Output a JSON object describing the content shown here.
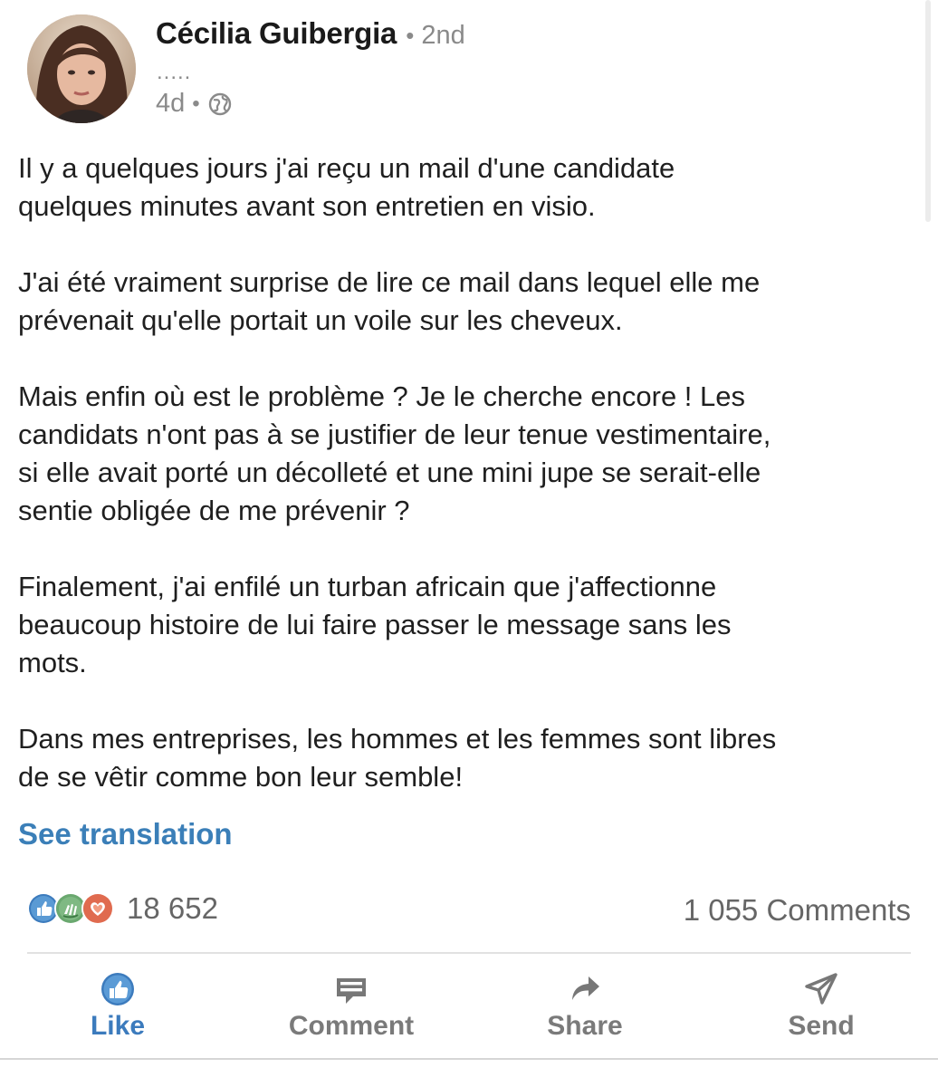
{
  "author": {
    "name": "Cécilia Guibergia",
    "separator": "•",
    "degree": "2nd",
    "headline": ".....",
    "time": "4d",
    "meta_separator": "•",
    "visibility_icon": "globe-icon"
  },
  "post": {
    "paragraphs": [
      "Il y a quelques jours j'ai reçu un mail d'une candidate\nquelques minutes avant son entretien en visio.",
      "J'ai été vraiment surprise de lire ce mail dans lequel elle me\nprévenait qu'elle portait un voile sur les cheveux.",
      "Mais enfin où est le problème ? Je le cherche encore ! Les\ncandidats n'ont pas à se justifier de leur tenue vestimentaire,\nsi elle avait porté un décolleté et une mini jupe se serait-elle\nsentie obligée de me prévenir ?",
      "Finalement, j'ai enfilé un turban africain que j'affectionne\nbeaucoup histoire de lui faire passer le message sans les\nmots.",
      "Dans mes entreprises, les hommes et les femmes sont libres\nde se vêtir comme bon leur semble!"
    ],
    "see_translation": "See translation"
  },
  "social": {
    "reaction_icons": [
      "like-reaction-icon",
      "celebrate-reaction-icon",
      "love-reaction-icon"
    ],
    "reaction_count": "18 652",
    "comments": "1 055 Comments"
  },
  "actions": {
    "like": "Like",
    "comment": "Comment",
    "share": "Share",
    "send": "Send"
  },
  "colors": {
    "accent": "#3c7bbd",
    "link": "#3b7fb8",
    "muted": "#7a7a7a",
    "love": "#e06b4f",
    "celebrate": "#4f9b5a"
  }
}
